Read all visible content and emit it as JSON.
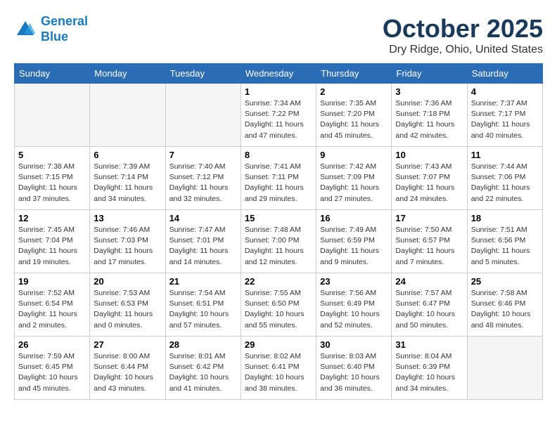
{
  "header": {
    "logo_line1": "General",
    "logo_line2": "Blue",
    "month": "October 2025",
    "location": "Dry Ridge, Ohio, United States"
  },
  "weekdays": [
    "Sunday",
    "Monday",
    "Tuesday",
    "Wednesday",
    "Thursday",
    "Friday",
    "Saturday"
  ],
  "weeks": [
    [
      {
        "day": "",
        "info": ""
      },
      {
        "day": "",
        "info": ""
      },
      {
        "day": "",
        "info": ""
      },
      {
        "day": "1",
        "info": "Sunrise: 7:34 AM\nSunset: 7:22 PM\nDaylight: 11 hours\nand 47 minutes."
      },
      {
        "day": "2",
        "info": "Sunrise: 7:35 AM\nSunset: 7:20 PM\nDaylight: 11 hours\nand 45 minutes."
      },
      {
        "day": "3",
        "info": "Sunrise: 7:36 AM\nSunset: 7:18 PM\nDaylight: 11 hours\nand 42 minutes."
      },
      {
        "day": "4",
        "info": "Sunrise: 7:37 AM\nSunset: 7:17 PM\nDaylight: 11 hours\nand 40 minutes."
      }
    ],
    [
      {
        "day": "5",
        "info": "Sunrise: 7:38 AM\nSunset: 7:15 PM\nDaylight: 11 hours\nand 37 minutes."
      },
      {
        "day": "6",
        "info": "Sunrise: 7:39 AM\nSunset: 7:14 PM\nDaylight: 11 hours\nand 34 minutes."
      },
      {
        "day": "7",
        "info": "Sunrise: 7:40 AM\nSunset: 7:12 PM\nDaylight: 11 hours\nand 32 minutes."
      },
      {
        "day": "8",
        "info": "Sunrise: 7:41 AM\nSunset: 7:11 PM\nDaylight: 11 hours\nand 29 minutes."
      },
      {
        "day": "9",
        "info": "Sunrise: 7:42 AM\nSunset: 7:09 PM\nDaylight: 11 hours\nand 27 minutes."
      },
      {
        "day": "10",
        "info": "Sunrise: 7:43 AM\nSunset: 7:07 PM\nDaylight: 11 hours\nand 24 minutes."
      },
      {
        "day": "11",
        "info": "Sunrise: 7:44 AM\nSunset: 7:06 PM\nDaylight: 11 hours\nand 22 minutes."
      }
    ],
    [
      {
        "day": "12",
        "info": "Sunrise: 7:45 AM\nSunset: 7:04 PM\nDaylight: 11 hours\nand 19 minutes."
      },
      {
        "day": "13",
        "info": "Sunrise: 7:46 AM\nSunset: 7:03 PM\nDaylight: 11 hours\nand 17 minutes."
      },
      {
        "day": "14",
        "info": "Sunrise: 7:47 AM\nSunset: 7:01 PM\nDaylight: 11 hours\nand 14 minutes."
      },
      {
        "day": "15",
        "info": "Sunrise: 7:48 AM\nSunset: 7:00 PM\nDaylight: 11 hours\nand 12 minutes."
      },
      {
        "day": "16",
        "info": "Sunrise: 7:49 AM\nSunset: 6:59 PM\nDaylight: 11 hours\nand 9 minutes."
      },
      {
        "day": "17",
        "info": "Sunrise: 7:50 AM\nSunset: 6:57 PM\nDaylight: 11 hours\nand 7 minutes."
      },
      {
        "day": "18",
        "info": "Sunrise: 7:51 AM\nSunset: 6:56 PM\nDaylight: 11 hours\nand 5 minutes."
      }
    ],
    [
      {
        "day": "19",
        "info": "Sunrise: 7:52 AM\nSunset: 6:54 PM\nDaylight: 11 hours\nand 2 minutes."
      },
      {
        "day": "20",
        "info": "Sunrise: 7:53 AM\nSunset: 6:53 PM\nDaylight: 11 hours\nand 0 minutes."
      },
      {
        "day": "21",
        "info": "Sunrise: 7:54 AM\nSunset: 6:51 PM\nDaylight: 10 hours\nand 57 minutes."
      },
      {
        "day": "22",
        "info": "Sunrise: 7:55 AM\nSunset: 6:50 PM\nDaylight: 10 hours\nand 55 minutes."
      },
      {
        "day": "23",
        "info": "Sunrise: 7:56 AM\nSunset: 6:49 PM\nDaylight: 10 hours\nand 52 minutes."
      },
      {
        "day": "24",
        "info": "Sunrise: 7:57 AM\nSunset: 6:47 PM\nDaylight: 10 hours\nand 50 minutes."
      },
      {
        "day": "25",
        "info": "Sunrise: 7:58 AM\nSunset: 6:46 PM\nDaylight: 10 hours\nand 48 minutes."
      }
    ],
    [
      {
        "day": "26",
        "info": "Sunrise: 7:59 AM\nSunset: 6:45 PM\nDaylight: 10 hours\nand 45 minutes."
      },
      {
        "day": "27",
        "info": "Sunrise: 8:00 AM\nSunset: 6:44 PM\nDaylight: 10 hours\nand 43 minutes."
      },
      {
        "day": "28",
        "info": "Sunrise: 8:01 AM\nSunset: 6:42 PM\nDaylight: 10 hours\nand 41 minutes."
      },
      {
        "day": "29",
        "info": "Sunrise: 8:02 AM\nSunset: 6:41 PM\nDaylight: 10 hours\nand 38 minutes."
      },
      {
        "day": "30",
        "info": "Sunrise: 8:03 AM\nSunset: 6:40 PM\nDaylight: 10 hours\nand 36 minutes."
      },
      {
        "day": "31",
        "info": "Sunrise: 8:04 AM\nSunset: 6:39 PM\nDaylight: 10 hours\nand 34 minutes."
      },
      {
        "day": "",
        "info": ""
      }
    ]
  ]
}
